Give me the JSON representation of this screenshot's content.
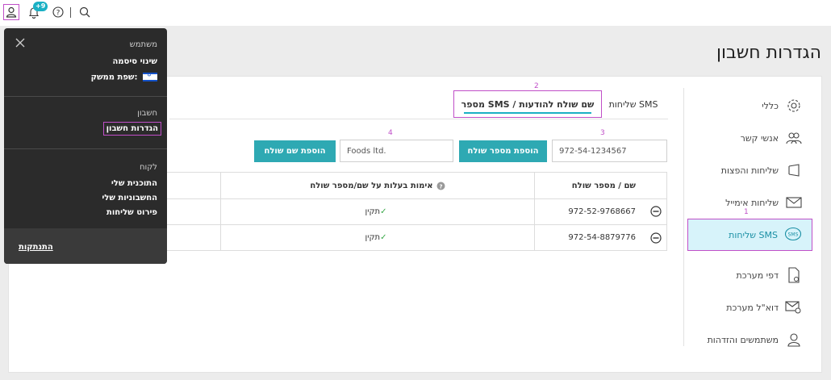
{
  "topbar": {
    "notifications_badge": "+9",
    "icons": [
      "user-icon",
      "bell-icon",
      "help-icon",
      "search-icon"
    ]
  },
  "page": {
    "title": "הגדרות חשבון"
  },
  "sidenav": {
    "items": [
      {
        "label": "כללי",
        "icon": "gear-icon"
      },
      {
        "label": "אנשי קשר",
        "icon": "contacts-icon"
      },
      {
        "label": "שליחות והפצות",
        "icon": "megaphone-icon"
      },
      {
        "label": "שליחות אימייל",
        "icon": "envelope-icon"
      },
      {
        "label": "שליחות SMS",
        "icon": "sms-bubble-icon",
        "active": true
      },
      {
        "label": "דפי מערכת",
        "icon": "page-gear-icon"
      },
      {
        "label": "דוא\"ל מערכת",
        "icon": "mail-gear-icon"
      },
      {
        "label": "משתמשים והזדהות",
        "icon": "user-icon"
      }
    ]
  },
  "annotations": {
    "a1": "1",
    "a2": "2",
    "a3": "3",
    "a4": "4"
  },
  "tabs": [
    {
      "label": "שליחות SMS"
    },
    {
      "label": "מספר SMS / שם שולח להודעות",
      "active": true
    }
  ],
  "form": {
    "phone_value": "972-54-1234567",
    "add_phone_label": "הוספת מספר שולח",
    "name_value": "Foods ltd.",
    "add_name_label": "הוספת שם שולח"
  },
  "table": {
    "headers": [
      "שם / מספר שולח",
      "אימות בעלות על שם/מספר שולח"
    ],
    "rows": [
      {
        "sender": "972-52-9768667",
        "status": "תקין"
      },
      {
        "sender": "972-54-8879776",
        "status": "תקין"
      }
    ]
  },
  "dropdown": {
    "user_heading": "משתמש",
    "change_password": "שינוי סיסמה",
    "language_label": "שפת ממשק:",
    "account_heading": "חשבון",
    "account_settings": "הגדרות חשבון",
    "customer_heading": "לקוח",
    "my_plan": "התוכנית שלי",
    "my_invoices": "החשבוניות שלי",
    "shipment_details": "פירוט שליחות",
    "logout": "התנתקות"
  },
  "colors": {
    "accent": "#2ea9b3",
    "highlight": "#c04fc8",
    "active_bg": "#d7f3fa",
    "menu_bg": "#2b2b2b"
  }
}
